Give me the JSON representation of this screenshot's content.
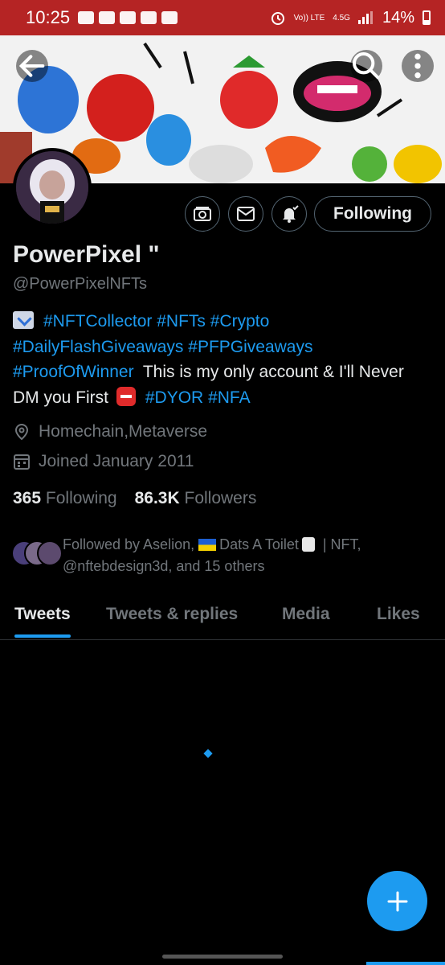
{
  "status_bar": {
    "time": "10:25",
    "network_label": "Vo)) LTE",
    "network_speed": "4.5G",
    "battery": "14%"
  },
  "profile": {
    "display_name": "PowerPixel \"",
    "handle": "@PowerPixelNFTs",
    "follow_button": "Following",
    "bio": {
      "tag1": "#NFTCollector",
      "tag2": "#NFTs",
      "tag3": "#Crypto",
      "tag4": "#DailyFlashGiveaways",
      "tag5": "#PFPGiveaways",
      "tag6": "#ProofOfWinner",
      "text1": "This is my only account & I'll Never DM you First",
      "tag7": "#DYOR",
      "tag8": "#NFA"
    },
    "location": "Homechain,Metaverse",
    "joined": "Joined January 2011",
    "following_count": "365",
    "following_label": "Following",
    "followers_count": "86.3K",
    "followers_label": "Followers",
    "followed_by": {
      "prefix": "Followed by Aselion,",
      "name2": "Dats A Toilet",
      "sep": "| NFT,",
      "rest": "@nftebdesign3d, and 15 others"
    }
  },
  "tabs": [
    {
      "label": "Tweets",
      "active": true
    },
    {
      "label": "Tweets & replies",
      "active": false
    },
    {
      "label": "Media",
      "active": false
    },
    {
      "label": "Likes",
      "active": false
    }
  ],
  "colors": {
    "accent": "#1d9bf0",
    "status_bar": "#b52424",
    "background": "#000000",
    "secondary_text": "#71767b"
  },
  "icons": [
    "back-arrow-icon",
    "search-icon",
    "more-icon",
    "camera-icon",
    "mail-icon",
    "notification-bell-icon",
    "location-icon",
    "calendar-icon",
    "compose-plus-icon"
  ]
}
